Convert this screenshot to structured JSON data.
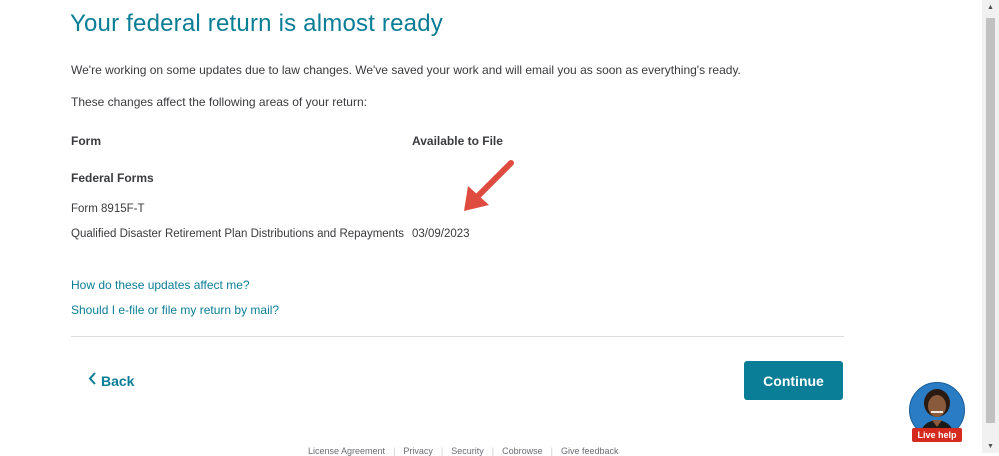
{
  "page": {
    "title": "Your federal return is almost ready",
    "intro": "We're working on some updates due to law changes. We've saved your work and will email you as soon as everything's ready.",
    "affects_text": "These changes affect the following areas of your return:"
  },
  "table": {
    "headers": [
      "Form",
      "Available to File"
    ],
    "section": "Federal Forms",
    "rows": [
      {
        "form": "Form 8915F-T",
        "desc": "Qualified Disaster Retirement Plan Distributions and Repayments",
        "date": "03/09/2023"
      }
    ]
  },
  "links": {
    "updates": "How do these updates affect me?",
    "efile": "Should I e-file or file my return by mail?"
  },
  "nav": {
    "back_label": "Back",
    "continue_label": "Continue"
  },
  "live_help": {
    "label": "Live help"
  },
  "footer": {
    "items": [
      "License Agreement",
      "Privacy",
      "Security",
      "Cobrowse",
      "Give feedback"
    ]
  },
  "colors": {
    "accent": "#0a7e96",
    "arrow": "#e04b3f",
    "live_help_badge": "#d52b1e"
  },
  "icons": {
    "back": "chevron-left-icon",
    "annotation": "arrow-icon"
  }
}
